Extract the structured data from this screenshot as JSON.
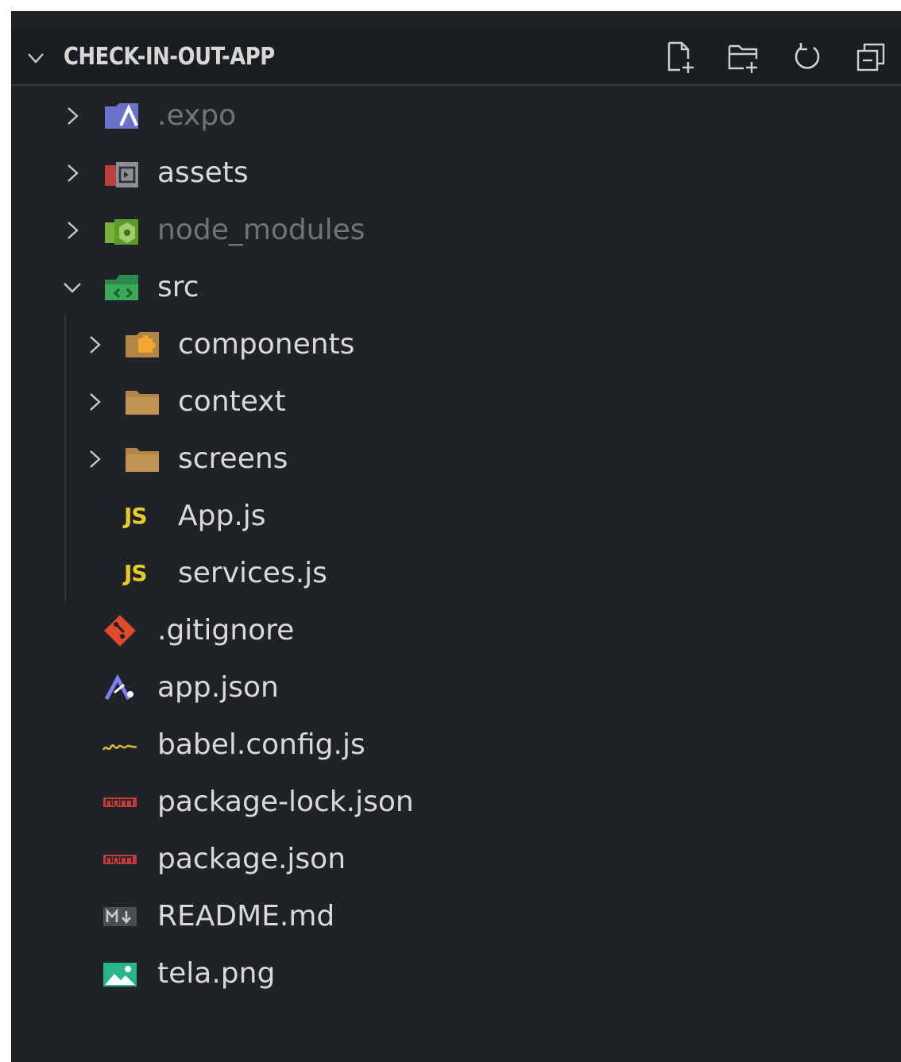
{
  "explorer": {
    "title": "CHECK-IN-OUT-APP",
    "actions": [
      "new-file",
      "new-folder",
      "refresh",
      "collapse-all"
    ]
  },
  "tree": [
    {
      "label": ".expo",
      "type": "folder",
      "expanded": false,
      "icon": "expo-folder-icon",
      "dim": true
    },
    {
      "label": "assets",
      "type": "folder",
      "expanded": false,
      "icon": "assets-folder-icon",
      "dim": false
    },
    {
      "label": "node_modules",
      "type": "folder",
      "expanded": false,
      "icon": "node-folder-icon",
      "dim": true
    },
    {
      "label": "src",
      "type": "folder",
      "expanded": true,
      "icon": "src-folder-icon",
      "dim": false
    },
    {
      "label": "components",
      "type": "folder",
      "expanded": false,
      "icon": "components-folder-icon",
      "dim": false
    },
    {
      "label": "context",
      "type": "folder",
      "expanded": false,
      "icon": "folder-icon",
      "dim": false
    },
    {
      "label": "screens",
      "type": "folder",
      "expanded": false,
      "icon": "folder-icon",
      "dim": false
    },
    {
      "label": "App.js",
      "type": "file",
      "icon": "js-file-icon",
      "icon_text": "JS"
    },
    {
      "label": "services.js",
      "type": "file",
      "icon": "js-file-icon",
      "icon_text": "JS"
    },
    {
      "label": ".gitignore",
      "type": "file",
      "icon": "git-icon"
    },
    {
      "label": "app.json",
      "type": "file",
      "icon": "expo-icon"
    },
    {
      "label": "babel.config.js",
      "type": "file",
      "icon": "babel-icon"
    },
    {
      "label": "package-lock.json",
      "type": "file",
      "icon": "npm-icon"
    },
    {
      "label": "package.json",
      "type": "file",
      "icon": "npm-icon"
    },
    {
      "label": "README.md",
      "type": "file",
      "icon": "markdown-icon"
    },
    {
      "label": "tela.png",
      "type": "file",
      "icon": "image-icon"
    }
  ],
  "colors": {
    "panel_bg": "#1f2227",
    "header_bg": "#1a1d21",
    "text": "#d9d9d9",
    "text_dim": "#6f747b",
    "js_yellow": "#e8c927",
    "npm_red": "#c0393b"
  }
}
